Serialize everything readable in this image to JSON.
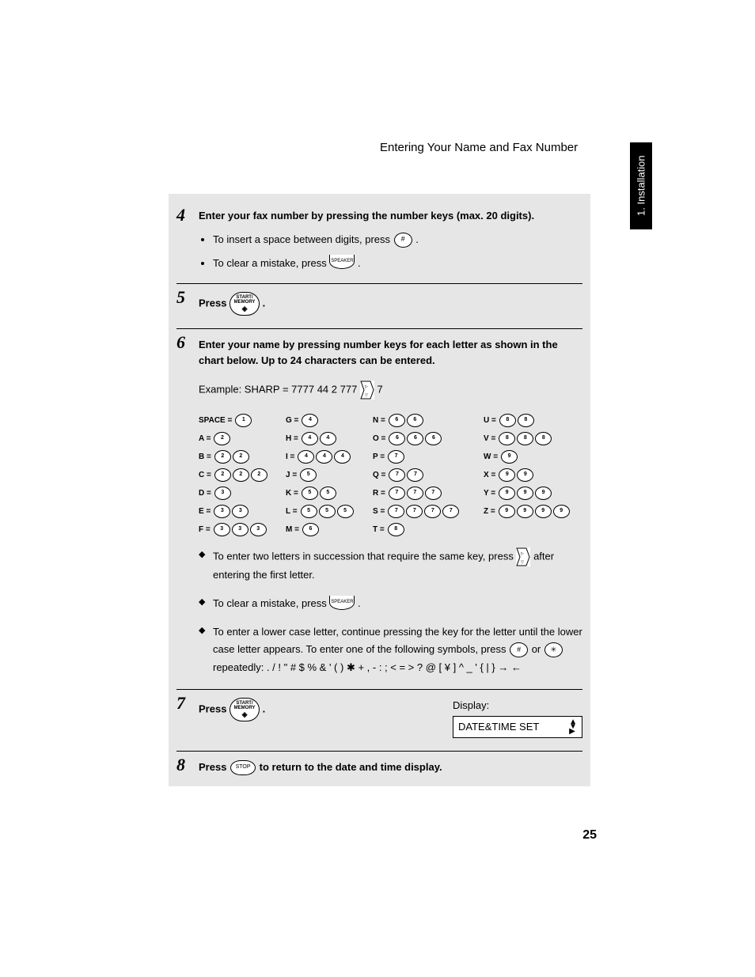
{
  "header": {
    "title": "Entering Your Name and Fax Number"
  },
  "sideTab": "1. Installation",
  "steps": {
    "s4": {
      "num": "4",
      "head": "Enter your fax number by pressing the number keys (max. 20 digits).",
      "b1a": "To insert a space between digits, press ",
      "b1key": "#",
      "b1b": " .",
      "b2a": "To clear a mistake, press ",
      "b2key": "SPEAKER",
      "b2b": "."
    },
    "s5": {
      "num": "5",
      "press": "Press ",
      "keyTop": "START/",
      "keyMid": "MEMORY",
      "period": " ."
    },
    "s6": {
      "num": "6",
      "head": "Enter your name by pressing number keys for each letter as shown in the chart below. Up to 24 characters can be entered.",
      "examplePrefix": "Example: SHARP = 7777  44  2  777 ",
      "exampleSuffix": " 7",
      "d1a": "To enter two letters in succession that require the same key, press ",
      "d1b": " after entering the first letter.",
      "d2a": "To clear a mistake, press ",
      "d2key": "SPEAKER",
      "d2b": ".",
      "d3a": "To enter a lower case letter, continue pressing the key for the letter until the lower case letter appears. To enter one of the following symbols, press ",
      "d3k1": "#",
      "d3mid": " or ",
      "d3k2": "✳",
      "d3b": " repeatedly: . / ! \" # $ % & ' ( ) ✱ + , - : ; < = > ? @ [ ¥ ] ^ _ ' { | } → ←"
    },
    "s7": {
      "num": "7",
      "press": "Press ",
      "keyTop": "START/",
      "keyMid": "MEMORY",
      "period": " .",
      "displayLabel": "Display:",
      "displayText": "DATE&TIME SET"
    },
    "s8": {
      "num": "8",
      "a": "Press ",
      "key": "STOP",
      "b": " to return to the date and time display."
    }
  },
  "charTable": {
    "col1": [
      {
        "l": "SPACE =",
        "k": [
          "1"
        ]
      },
      {
        "l": "A =",
        "k": [
          "2"
        ]
      },
      {
        "l": "B =",
        "k": [
          "2",
          "2"
        ]
      },
      {
        "l": "C =",
        "k": [
          "2",
          "2",
          "2"
        ]
      },
      {
        "l": "D =",
        "k": [
          "3"
        ]
      },
      {
        "l": "E =",
        "k": [
          "3",
          "3"
        ]
      },
      {
        "l": "F =",
        "k": [
          "3",
          "3",
          "3"
        ]
      }
    ],
    "col2": [
      {
        "l": "G =",
        "k": [
          "4"
        ]
      },
      {
        "l": "H =",
        "k": [
          "4",
          "4"
        ]
      },
      {
        "l": "I =",
        "k": [
          "4",
          "4",
          "4"
        ]
      },
      {
        "l": "J =",
        "k": [
          "5"
        ]
      },
      {
        "l": "K =",
        "k": [
          "5",
          "5"
        ]
      },
      {
        "l": "L =",
        "k": [
          "5",
          "5",
          "5"
        ]
      },
      {
        "l": "M =",
        "k": [
          "6"
        ]
      }
    ],
    "col3": [
      {
        "l": "N =",
        "k": [
          "6",
          "6"
        ]
      },
      {
        "l": "O =",
        "k": [
          "6",
          "6",
          "6"
        ]
      },
      {
        "l": "P =",
        "k": [
          "7"
        ]
      },
      {
        "l": "Q =",
        "k": [
          "7",
          "7"
        ]
      },
      {
        "l": "R =",
        "k": [
          "7",
          "7",
          "7"
        ]
      },
      {
        "l": "S =",
        "k": [
          "7",
          "7",
          "7",
          "7"
        ]
      },
      {
        "l": "T =",
        "k": [
          "8"
        ]
      }
    ],
    "col4": [
      {
        "l": "U =",
        "k": [
          "8",
          "8"
        ]
      },
      {
        "l": "V =",
        "k": [
          "8",
          "8",
          "8"
        ]
      },
      {
        "l": "W =",
        "k": [
          "9"
        ]
      },
      {
        "l": "X =",
        "k": [
          "9",
          "9"
        ]
      },
      {
        "l": "Y =",
        "k": [
          "9",
          "9",
          "9"
        ]
      },
      {
        "l": "Z =",
        "k": [
          "9",
          "9",
          "9",
          "9"
        ]
      }
    ]
  },
  "pageNumber": "25"
}
